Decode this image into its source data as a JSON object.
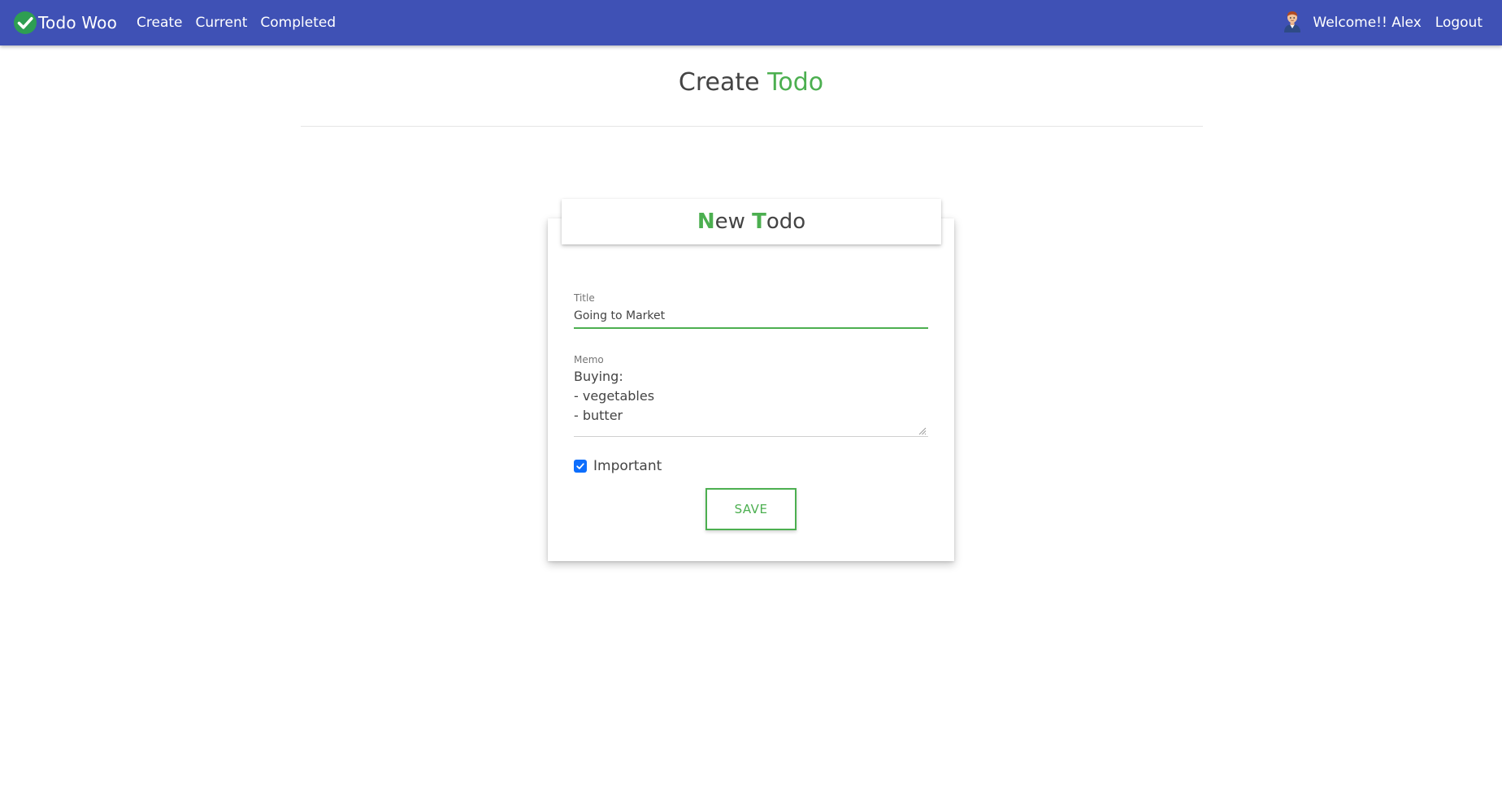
{
  "navbar": {
    "brand_icon": "check-circle-icon",
    "brand_label": "Todo Woo",
    "links": [
      "Create",
      "Current",
      "Completed"
    ],
    "avatar_icon": "user-avatar-icon",
    "welcome_text": "Welcome!! Alex",
    "logout_label": "Logout",
    "background_color": "#3f51b5"
  },
  "page": {
    "title_prefix": "Create",
    "title_accent": "Todo",
    "accent_color": "#4caf50"
  },
  "card": {
    "header": {
      "first_cap": "N",
      "first_rest": "ew",
      "second_cap": "T",
      "second_rest": "odo"
    },
    "title_field": {
      "label": "Title",
      "value": "Going to Market"
    },
    "memo_field": {
      "label": "Memo",
      "value": "Buying:\n- vegetables\n- butter"
    },
    "important": {
      "label": "Important",
      "checked": true,
      "check_icon": "checkmark-icon"
    },
    "save_label": "SAVE"
  }
}
